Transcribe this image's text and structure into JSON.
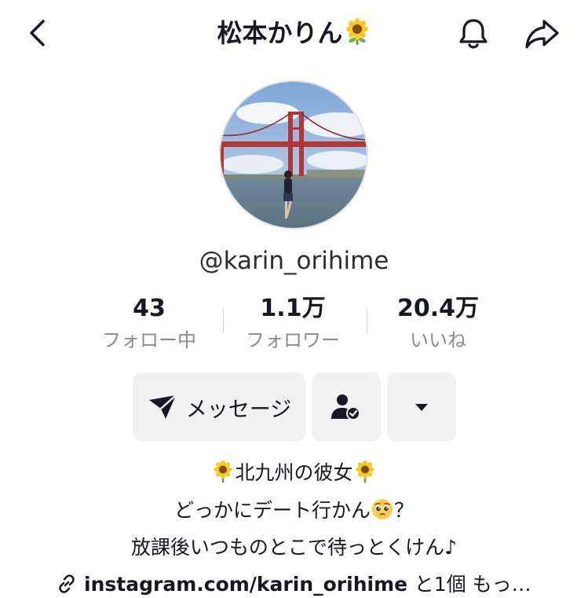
{
  "header": {
    "title": "松本かりん",
    "title_emoji": "🌻"
  },
  "icons": {
    "back": "chevron-left-icon",
    "notifications": "bell-icon",
    "share": "share-arrow-icon",
    "sunflower": "sunflower-emoji",
    "pleading": "pleading-face-emoji",
    "link": "link-icon"
  },
  "profile": {
    "username": "@karin_orihime",
    "stats": [
      {
        "value": "43",
        "label": "フォロー中"
      },
      {
        "value": "1.1万",
        "label": "フォロワー"
      },
      {
        "value": "20.4万",
        "label": "いいね"
      }
    ]
  },
  "actions": {
    "message_label": "メッセージ"
  },
  "bio": {
    "line1_text": "北九州の彼女",
    "line2_text": "どっかにデート行かん",
    "line2_suffix": "？",
    "line3_text": "放課後いつものとこで待っとくけん♪",
    "link_text": "instagram.com/karin_orihime",
    "link_more": "と1個 もっ…"
  },
  "colors": {
    "text": "#161823",
    "secondary_text": "#8a8b91",
    "button_bg": "#f1f1f2"
  }
}
